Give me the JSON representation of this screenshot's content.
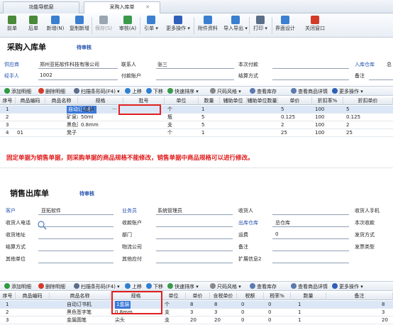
{
  "tabs": [
    "功能导航窗",
    "采购入库单"
  ],
  "toolbar": [
    {
      "label": "前单",
      "color": "#4a8a3a"
    },
    {
      "label": "后单",
      "color": "#4a8a3a"
    },
    {
      "label": "新增(N)",
      "color": "#3a7fd0"
    },
    {
      "label": "复制新增",
      "color": "#3a7fd0"
    },
    {
      "label": "保存(S)",
      "color": "#9aa6b2"
    },
    {
      "label": "审核(A)",
      "color": "#3a9a4a"
    },
    {
      "label": "引单 ▾",
      "color": "#3a7fd0"
    },
    {
      "label": "更多操作 ▾",
      "color": "#2f5fb8"
    },
    {
      "label": "附件资料",
      "color": "#3a7fd0"
    },
    {
      "label": "导入导出 ▾",
      "color": "#3a7fd0"
    },
    {
      "label": "打印 ▾",
      "color": "#5a6e8a"
    },
    {
      "label": "界面设计",
      "color": "#3a7fd0"
    },
    {
      "label": "关闭窗口",
      "color": "#d43a2a"
    }
  ],
  "purchase": {
    "title": "采购入库单",
    "status": "待审核",
    "fields": {
      "supplier_label": "供应商",
      "supplier_value": "郑州亚拓软件科技有限公司",
      "contact_label": "联系人",
      "contact_value": "张三",
      "payment_label": "本次付款",
      "warehouse_label": "入库仓库",
      "warehouse_value": "总",
      "handler_label": "经手人",
      "handler_value": "1002",
      "account_label": "付款账户",
      "settle_label": "结算方式",
      "remark_label": "备注"
    },
    "grid_toolbar": [
      "添加明细",
      "删除明细",
      "扫描条形码(F4) ▾",
      "上移",
      "下移",
      "快速排序 ▾",
      "尺码风格 ▾",
      "查看库存",
      "查看商品详情",
      "更多操作 ▾"
    ],
    "columns": [
      "序号",
      "商品编码",
      "商品名称",
      "规格",
      "批号",
      "单位",
      "数量",
      "辅助单位",
      "辅助单位数量",
      "单价",
      "折扣率%",
      "折扣单价"
    ],
    "rows": [
      {
        "no": "1",
        "code": "",
        "name": "自动订书机",
        "spec": "1盒装",
        "batch": "",
        "unit": "个",
        "qty": "1",
        "aux": "",
        "auxqty": "",
        "price": "5",
        "disc": "100",
        "dprice": "5"
      },
      {
        "no": "2",
        "code": "",
        "name": "矿泉水",
        "spec": "50ml",
        "batch": "",
        "unit": "瓶",
        "qty": "5",
        "aux": "",
        "auxqty": "",
        "price": "0.125",
        "disc": "100",
        "dprice": "0.125"
      },
      {
        "no": "3",
        "code": "",
        "name": "黑色签字笔",
        "spec": "0.8mm",
        "batch": "",
        "unit": "支",
        "qty": "5",
        "aux": "",
        "auxqty": "",
        "price": "2",
        "disc": "100",
        "dprice": "2"
      },
      {
        "no": "4",
        "code": "01",
        "name": "凳子",
        "spec": "",
        "batch": "",
        "unit": "个",
        "qty": "1",
        "aux": "",
        "auxqty": "",
        "price": "25",
        "disc": "100",
        "dprice": "25"
      }
    ]
  },
  "note": "固定单据为销售单据，则采购单据的商品规格不能修改，销售单据中商品规格可以进行修改。",
  "sales": {
    "title": "销售出库单",
    "status": "待审核",
    "fields": {
      "customer_label": "客户",
      "customer_value": "亚拓软件",
      "salesman_label": "业务员",
      "salesman_value": "系统管理员",
      "receiver_label": "收货人",
      "receiver_phone_label": "收货人手机",
      "rphone_label": "收货人电话",
      "account_label": "收款账户",
      "out_wh_label": "出库仓库",
      "out_wh_value": "总仓库",
      "receipt_label": "本次收款",
      "raddr_label": "收货地址",
      "dept_label": "部门",
      "freight_label": "运费",
      "freight_value": "0",
      "ship_label": "发货方式",
      "settle_label": "结算方式",
      "logistics_label": "物流公司",
      "remark_label": "备注",
      "invoice_label": "发票类型",
      "other_unit_label": "其他单位",
      "other_pay_label": "其他应付",
      "ext_label": "扩展信息2"
    },
    "grid_toolbar": [
      "添加明细",
      "删除明细",
      "扫描条形码(F4) ▾",
      "上移",
      "下移",
      "快速排序 ▾",
      "尺码风格 ▾",
      "查看库存",
      "查看商品详情",
      "更多操作 ▾"
    ],
    "columns": [
      "序号",
      "商品编码",
      "商品名称",
      "规格",
      "单位",
      "单价",
      "含税单价",
      "税额",
      "税率%",
      "数量",
      "备注"
    ],
    "rows": [
      {
        "no": "1",
        "code": "",
        "name": "自动订书机",
        "spec": "1盒装",
        "unit": "个",
        "price": "8",
        "tprice": "8",
        "tax": "0",
        "rate": "0",
        "qty": "1",
        "remark": "",
        "extra": "8"
      },
      {
        "no": "2",
        "code": "",
        "name": "黑色签字笔",
        "spec": "0.8mm",
        "unit": "支",
        "price": "3",
        "tprice": "3",
        "tax": "0",
        "rate": "0",
        "qty": "1",
        "remark": "",
        "extra": "3"
      },
      {
        "no": "3",
        "code": "",
        "name": "金属圆笔",
        "spec": "尖头",
        "unit": "支",
        "price": "20",
        "tprice": "20",
        "tax": "0",
        "rate": "0",
        "qty": "1",
        "remark": "",
        "extra": "20"
      }
    ]
  }
}
